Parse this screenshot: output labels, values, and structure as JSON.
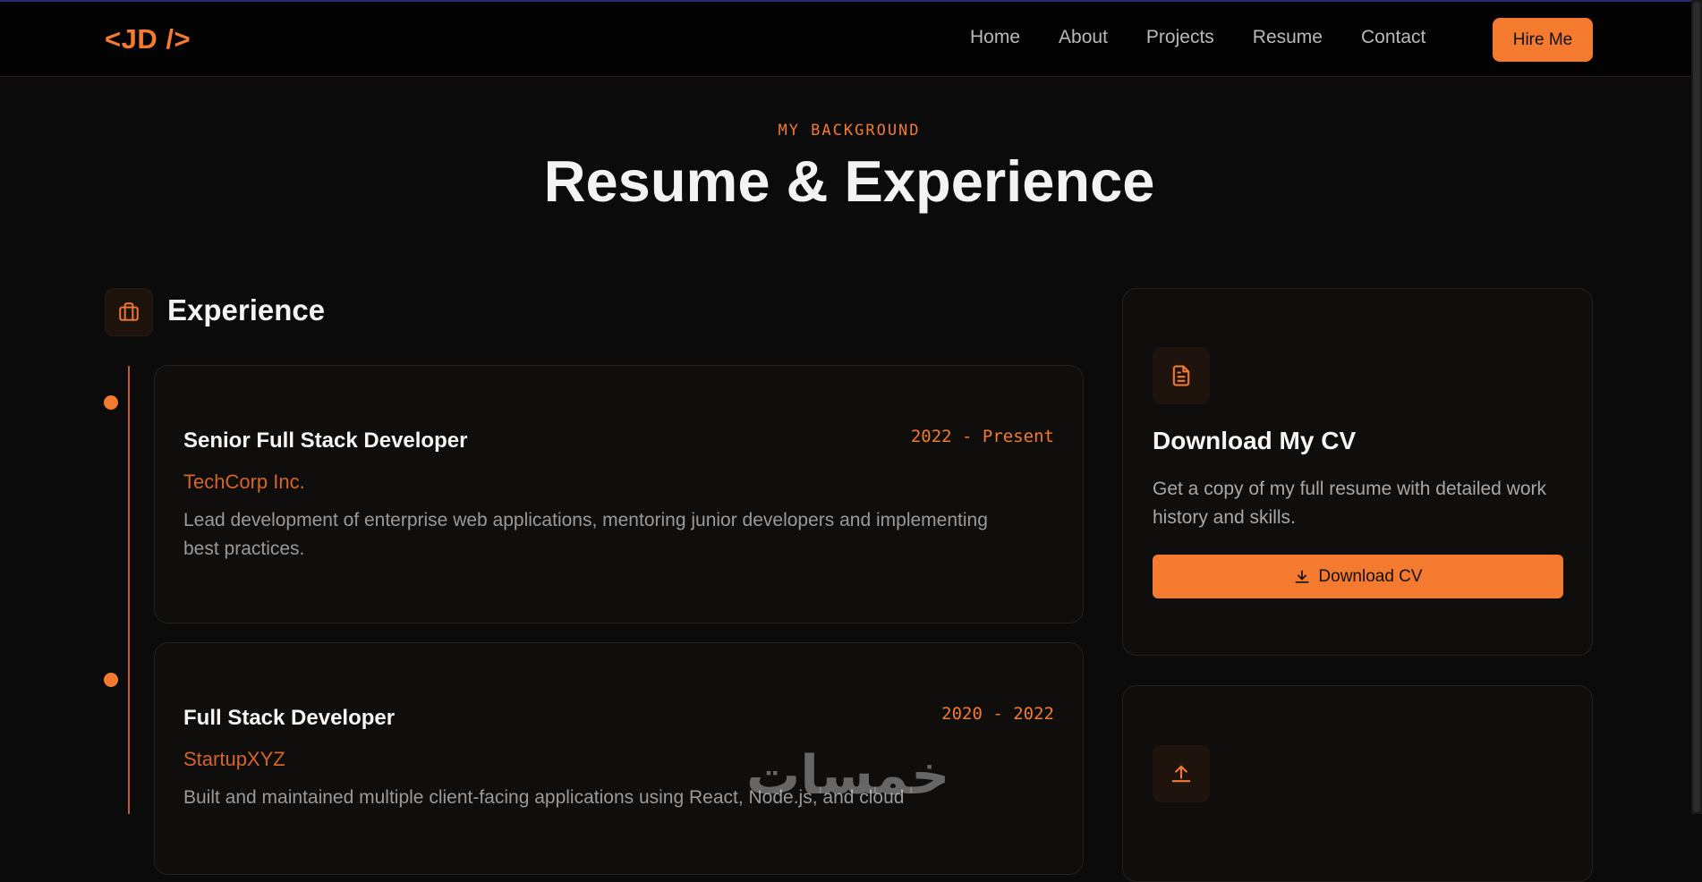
{
  "nav": {
    "logo": "<JD />",
    "links": [
      "Home",
      "About",
      "Projects",
      "Resume",
      "Contact"
    ],
    "cta": "Hire Me"
  },
  "header": {
    "eyebrow": "MY BACKGROUND",
    "title": "Resume & Experience"
  },
  "experience": {
    "heading": "Experience",
    "icon": "briefcase-icon",
    "items": [
      {
        "title": "Senior Full Stack Developer",
        "date": "2022 - Present",
        "company": "TechCorp Inc.",
        "description": "Lead development of enterprise web applications, mentoring junior developers and implementing best practices."
      },
      {
        "title": "Full Stack Developer",
        "date": "2020 - 2022",
        "company": "StartupXYZ",
        "description": "Built and maintained multiple client-facing applications using React, Node.js, and cloud"
      }
    ]
  },
  "cv": {
    "icon": "document-icon",
    "title": "Download My CV",
    "text": "Get a copy of my full resume with detailed work history and skills.",
    "button": "Download CV"
  },
  "upload": {
    "icon": "upload-icon"
  },
  "watermark": "خمسات",
  "colors": {
    "accent": "#f47a30",
    "background": "#0b0b0b",
    "card": "#0f0e0d"
  }
}
